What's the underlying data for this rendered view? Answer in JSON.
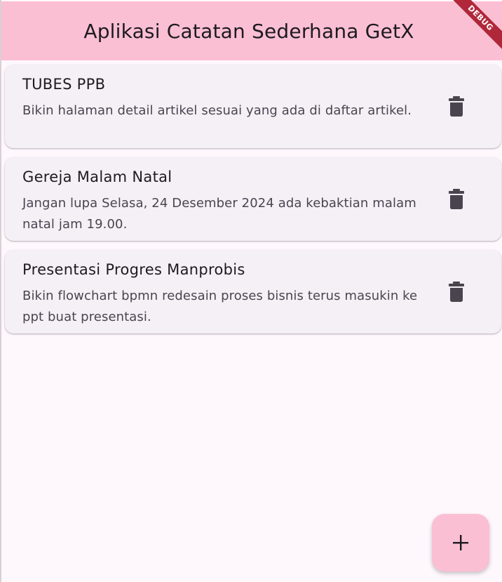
{
  "app_bar": {
    "title": "Aplikasi Catatan Sederhana GetX",
    "background": "#fbbfd3"
  },
  "debug_banner": {
    "label": "DEBUG",
    "color": "#b0273a"
  },
  "notes": [
    {
      "title": "TUBES PPB",
      "body": "Bikin halaman detail artikel sesuai yang ada di daftar artikel.",
      "action_icon": "trash-icon"
    },
    {
      "title": "Gereja Malam Natal",
      "body": "Jangan lupa Selasa, 24 Desember 2024 ada kebaktian malam natal jam 19.00.",
      "action_icon": "trash-icon"
    },
    {
      "title": "Presentasi Progres Manprobis",
      "body": "Bikin flowchart bpmn redesain proses bisnis terus masukin ke ppt buat presentasi.",
      "action_icon": "trash-icon"
    }
  ],
  "fab": {
    "icon": "plus-icon",
    "background": "#fbbfd3"
  },
  "colors": {
    "page_background": "#fef7fc",
    "card_background": "#f5eff6",
    "title_text": "#1d1b20",
    "body_text": "#49454f",
    "icon": "#49454f"
  }
}
